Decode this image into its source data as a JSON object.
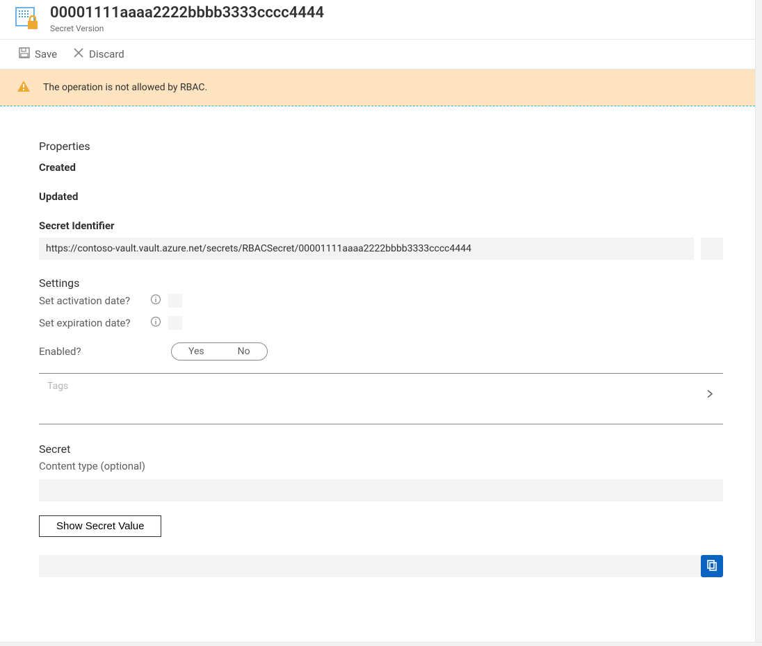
{
  "header": {
    "title": "00001111aaaa2222bbbb3333cccc4444",
    "subtitle": "Secret Version"
  },
  "commands": {
    "save": "Save",
    "discard": "Discard"
  },
  "banner": {
    "message": "The operation is not allowed by RBAC."
  },
  "properties": {
    "section_title": "Properties",
    "created_label": "Created",
    "updated_label": "Updated",
    "secret_identifier_label": "Secret Identifier",
    "secret_identifier_value": "https://contoso-vault.vault.azure.net/secrets/RBACSecret/00001111aaaa2222bbbb3333cccc4444"
  },
  "settings": {
    "section_title": "Settings",
    "activation_label": "Set activation date?",
    "expiration_label": "Set expiration date?",
    "enabled_label": "Enabled?",
    "yes": "Yes",
    "no": "No",
    "tags_label": "Tags"
  },
  "secret": {
    "section_title": "Secret",
    "content_type_label": "Content type (optional)",
    "show_button": "Show Secret Value"
  }
}
